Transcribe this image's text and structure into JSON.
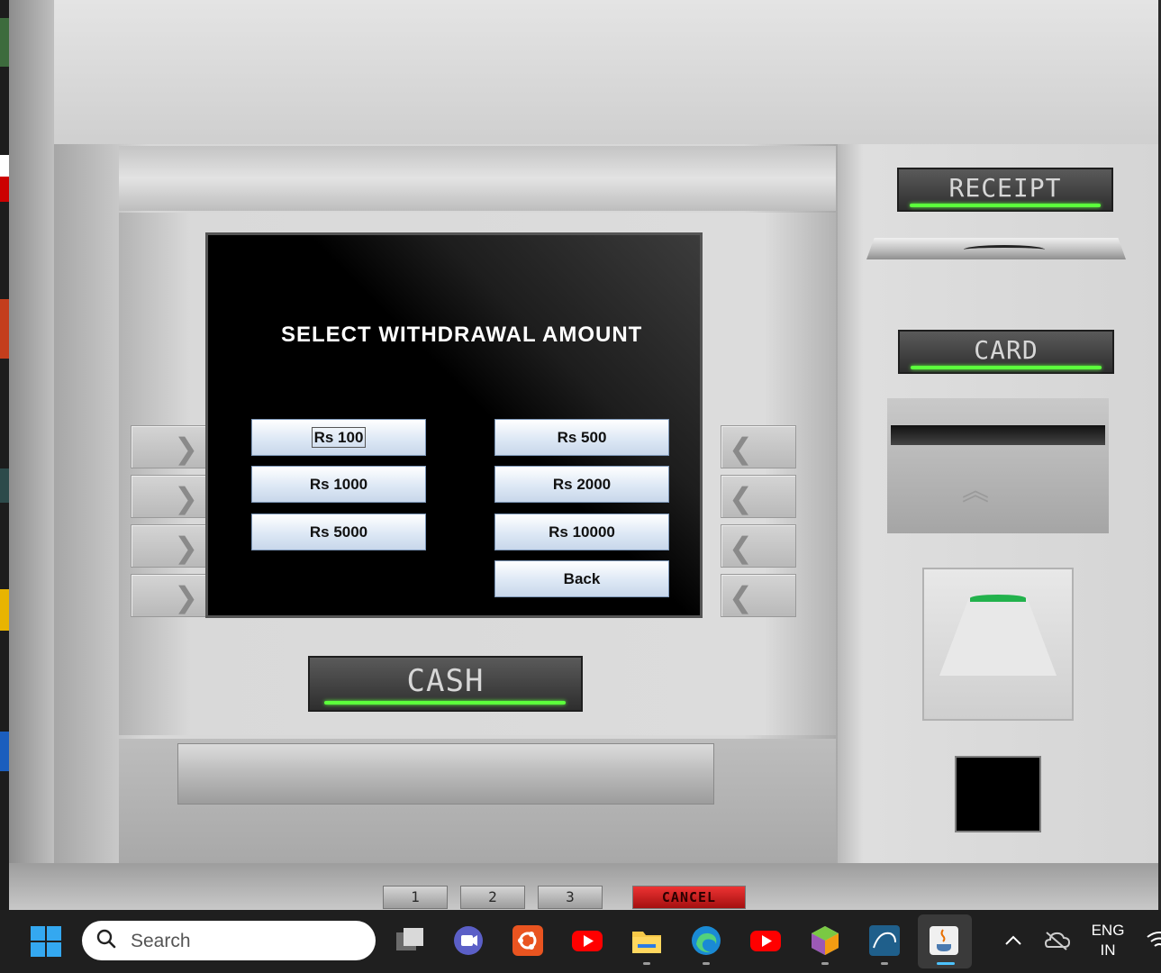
{
  "atm": {
    "screen_title": "SELECT WITHDRAWAL AMOUNT",
    "amount_buttons": [
      "Rs 100",
      "Rs 500",
      "Rs 1000",
      "Rs 2000",
      "Rs 5000",
      "Rs 10000"
    ],
    "back_label": "Back",
    "receipt_label": "RECEIPT",
    "card_label": "CARD",
    "cash_label": "CASH",
    "keys": [
      "1",
      "2",
      "3"
    ],
    "cancel_label": "CANCEL",
    "led_color": "#5cff3c",
    "screen_color": "#000000"
  },
  "taskbar": {
    "search_placeholder": "Search",
    "lang_line1": "ENG",
    "lang_line2": "IN",
    "apps": [
      "windows-start-icon",
      "task-view-icon",
      "teams-icon",
      "ubuntu-icon",
      "youtube-icon",
      "file-explorer-icon",
      "edge-icon",
      "youtube-icon",
      "virtualbox-icon",
      "mysql-icon",
      "java-icon"
    ]
  }
}
